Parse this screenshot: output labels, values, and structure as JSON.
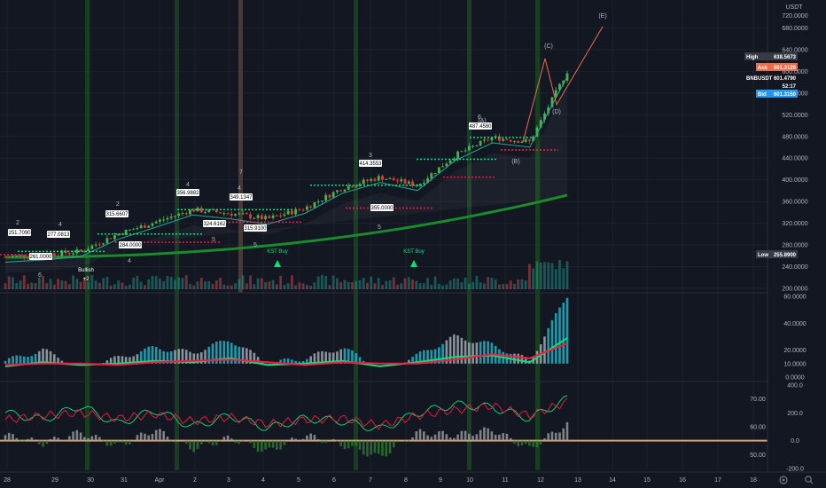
{
  "header": {
    "currency": "USDT",
    "top_price": "720.0000"
  },
  "price_axis": {
    "ticks": [
      "680.0000",
      "640.0000",
      "600.0000",
      "560.0000",
      "520.0000",
      "480.0000",
      "440.0000",
      "400.0000",
      "360.0000",
      "320.0000",
      "280.0000",
      "240.0000",
      "200.0000"
    ],
    "values": [
      680,
      640,
      600,
      560,
      520,
      480,
      440,
      400,
      360,
      320,
      280,
      240,
      200
    ]
  },
  "tags": {
    "high_label": "High",
    "high_value": "638.5673",
    "ask_label": "Ask",
    "ask_value": "601.3126",
    "symbol": "BNBUSDT",
    "last_value": "601.4790",
    "countdown": "52:17",
    "bid_label": "Bid",
    "bid_value": "601.3150",
    "low_label": "Low",
    "low_value": "255.8900"
  },
  "colors": {
    "background": "#131722",
    "up": "#26a69a",
    "down": "#ef5350",
    "green": "#00e676",
    "red": "#ff1744",
    "bid": "#2196f3",
    "ask": "#ef6c4a"
  },
  "waves": {
    "elliott_counts": [
      "2",
      "4",
      "6",
      "2",
      "4",
      "4",
      "5",
      "4",
      "5",
      "3",
      "5",
      "6",
      "7"
    ],
    "corrective": [
      "(A)",
      "(B)",
      "(C)",
      "(D)",
      "(E)"
    ]
  },
  "annotations": {
    "bullish": "Bullish",
    "bullish_sub": "+2",
    "kst_buy": "KST Buy",
    "price_labels": [
      "251.7090",
      "277.0813",
      "261.0000",
      "315.6607",
      "284.0000",
      "356.9882",
      "324.6162",
      "349.1347",
      "315.9100",
      "414.3553",
      "355.0000",
      "487.4580"
    ]
  },
  "chart_data": [
    {
      "type": "line",
      "panel": "price",
      "title": "",
      "xlabel": "",
      "ylabel": "",
      "ylim": [
        195,
        725
      ],
      "grid": true,
      "x": [
        "28",
        "29",
        "30",
        "31",
        "Apr",
        "2",
        "3",
        "4",
        "5",
        "6",
        "7",
        "8",
        "9",
        "10",
        "11",
        "12"
      ],
      "series": [
        {
          "values": [
            258,
            262,
            268,
            300,
            322,
            345,
            338,
            328,
            348,
            385,
            405,
            390,
            445,
            478,
            470,
            600
          ]
        }
      ]
    },
    {
      "type": "bar",
      "panel": "oscillator-1",
      "title": "",
      "ylim": [
        0,
        60
      ],
      "y_ticks": [
        "60.0000",
        "40.0000",
        "20.0000",
        "10.0000",
        "0.0000"
      ],
      "y_values": [
        60,
        40,
        20,
        10,
        0
      ],
      "series": [
        {
          "values": [
            12,
            20,
            8,
            14,
            22,
            18,
            28,
            10,
            14,
            22,
            6,
            16,
            30,
            24,
            12,
            60
          ]
        },
        {
          "values": [
            6,
            12,
            8,
            10,
            14,
            12,
            18,
            8,
            10,
            14,
            6,
            12,
            20,
            22,
            12,
            48
          ]
        },
        {
          "values": [
            8,
            10,
            10,
            8,
            12,
            14,
            16,
            12,
            8,
            12,
            10,
            10,
            16,
            24,
            18,
            40
          ]
        }
      ]
    },
    {
      "type": "bar",
      "panel": "oscillator-2",
      "title": "",
      "ylim": [
        -200,
        400
      ],
      "y_ticks": [
        "400.0",
        "200.0",
        "0.0",
        "-200.0"
      ],
      "y_values": [
        400,
        200,
        0,
        -200
      ],
      "left_ticks": [
        "70.00",
        "60.00",
        "50.00"
      ],
      "left_values": [
        70,
        60,
        50
      ],
      "series": [
        {
          "values": [
            40,
            -20,
            60,
            -40,
            80,
            -60,
            20,
            -80,
            40,
            -30,
            -120,
            60,
            40,
            80,
            -60,
            120
          ]
        },
        {
          "values": [
            200,
            150,
            250,
            120,
            220,
            100,
            180,
            90,
            160,
            140,
            80,
            200,
            260,
            240,
            160,
            300
          ]
        },
        {
          "values": [
            150,
            180,
            200,
            160,
            190,
            140,
            170,
            120,
            150,
            160,
            110,
            180,
            220,
            250,
            180,
            280
          ]
        }
      ]
    }
  ],
  "time_axis": {
    "labels": [
      "28",
      "29",
      "30",
      "31",
      "Apr",
      "2",
      "3",
      "4",
      "5",
      "6",
      "7",
      "8",
      "9",
      "10",
      "11",
      "12",
      "13",
      "14",
      "15",
      "16",
      "17",
      "18"
    ]
  },
  "footer": {
    "settings_icon": "gear-icon",
    "zoom_icon": "magnifier-icon"
  }
}
